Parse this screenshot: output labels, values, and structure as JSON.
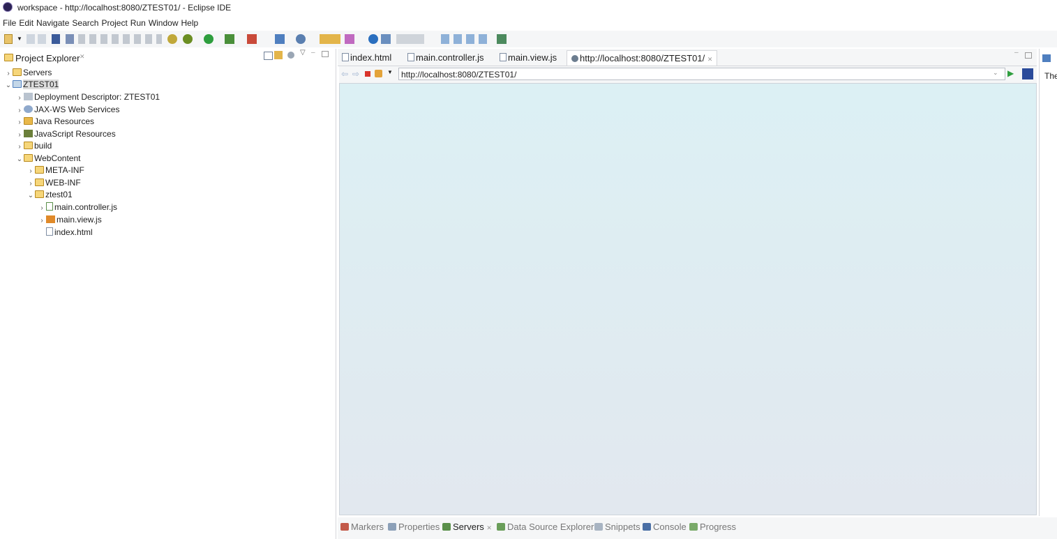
{
  "window": {
    "title": "workspace - http://localhost:8080/ZTEST01/ - Eclipse IDE"
  },
  "menu": [
    "File",
    "Edit",
    "Navigate",
    "Search",
    "Project",
    "Run",
    "Window",
    "Help"
  ],
  "explorer": {
    "title": "Project Explorer",
    "close_glyph": "✕",
    "tree": {
      "servers": "Servers",
      "project": "ZTEST01",
      "deployment": "Deployment Descriptor: ZTEST01",
      "jaxws": "JAX-WS Web Services",
      "java_res": "Java Resources",
      "js_res": "JavaScript Resources",
      "build": "build",
      "webcontent": "WebContent",
      "metainf": "META-INF",
      "webinf": "WEB-INF",
      "ztest01": "ztest01",
      "controller": "main.controller.js",
      "view": "main.view.js",
      "index": "index.html"
    }
  },
  "editor": {
    "tabs": [
      "index.html",
      "main.controller.js",
      "main.view.js",
      "http://localhost:8080/ZTEST01/"
    ],
    "active_tab_close": "✕",
    "url": "http://localhost:8080/ZTEST01/"
  },
  "right_panel": {
    "label": "The"
  },
  "bottom": {
    "tabs": [
      "Markers",
      "Properties",
      "Servers",
      "Data Source Explorer",
      "Snippets",
      "Console",
      "Progress"
    ],
    "active_close": "✕"
  },
  "colors": {
    "accent": "#1a73e8",
    "browser_bg_top": "#dcf0f4",
    "browser_bg_bottom": "#e2e8ef"
  }
}
